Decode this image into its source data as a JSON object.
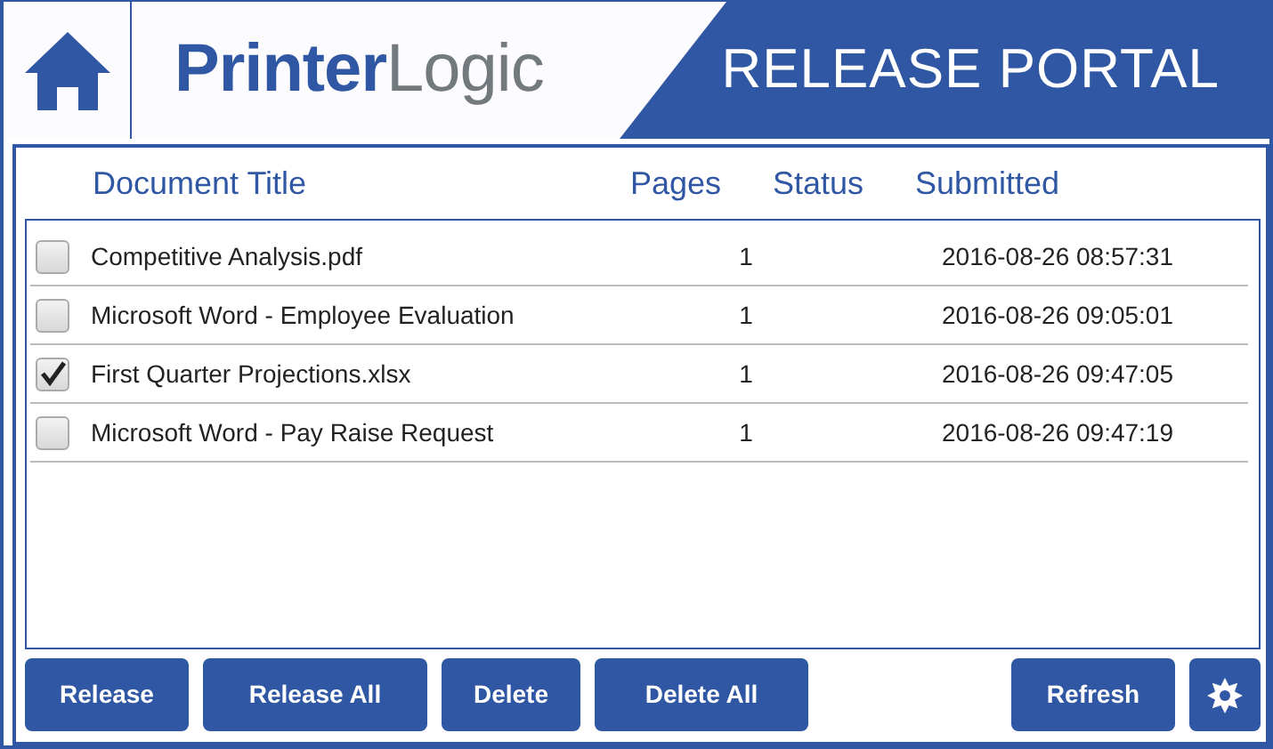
{
  "header": {
    "logo": [
      "Printer",
      "Logic"
    ],
    "title": "RELEASE PORTAL"
  },
  "table": {
    "columns": [
      "Document Title",
      "Pages",
      "Status",
      "Submitted"
    ],
    "rows": [
      {
        "title": "Competitive Analysis.pdf",
        "pages": "1",
        "submitted": "2016-08-26 08:57:31",
        "checked": false
      },
      {
        "title": "Microsoft Word - Employee Evaluation",
        "pages": "1",
        "submitted": "2016-08-26 09:05:01",
        "checked": false
      },
      {
        "title": "First Quarter Projections.xlsx",
        "pages": "1",
        "submitted": "2016-08-26 09:47:05",
        "checked": true
      },
      {
        "title": "Microsoft Word - Pay Raise Request",
        "pages": "1",
        "submitted": "2016-08-26 09:47:19",
        "checked": false
      }
    ]
  },
  "buttons": [
    "Release",
    "Release All",
    "Delete",
    "Delete All"
  ],
  "refresh_button": "Refresh"
}
